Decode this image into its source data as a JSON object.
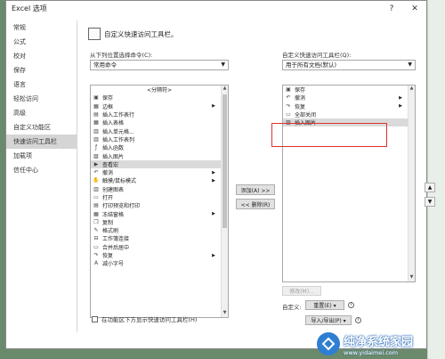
{
  "window": {
    "title": "Excel 选项",
    "help": "?",
    "close": "✕"
  },
  "nav": {
    "items": [
      "常规",
      "公式",
      "校对",
      "保存",
      "语言",
      "轻松访问",
      "高级",
      "自定义功能区",
      "快速访问工具栏",
      "加载项",
      "信任中心"
    ],
    "active_index": 8
  },
  "main": {
    "heading": "自定义快速访问工具栏。",
    "left_label": "从下列位置选择命令(C):",
    "left_select": "常用命令",
    "right_label": "自定义快速访问工具栏(Q):",
    "right_select": "用于所有文档(默认)",
    "commands": [
      {
        "icon": "",
        "label": "<分隔符>",
        "sub": false
      },
      {
        "icon": "save-icon",
        "label": "保存",
        "sub": false
      },
      {
        "icon": "border-icon",
        "label": "边框",
        "sub": true
      },
      {
        "icon": "insert-row-icon",
        "label": "插入工作表行",
        "sub": false
      },
      {
        "icon": "table-icon",
        "label": "插入表格",
        "sub": false
      },
      {
        "icon": "insert-cell-icon",
        "label": "插入单元格...",
        "sub": false
      },
      {
        "icon": "insert-col-icon",
        "label": "插入工作表列",
        "sub": false
      },
      {
        "icon": "function-icon",
        "label": "插入函数",
        "sub": false
      },
      {
        "icon": "picture-icon",
        "label": "插入图片",
        "sub": false
      },
      {
        "icon": "play-icon",
        "label": "查看宏",
        "sub": false
      },
      {
        "icon": "undo-icon",
        "label": "撤消",
        "sub": true
      },
      {
        "icon": "sort-icon",
        "label": "触摸/鼠标模式",
        "sub": true
      },
      {
        "icon": "chart-icon",
        "label": "创建图表",
        "sub": false
      },
      {
        "icon": "folder-open-icon",
        "label": "打开",
        "sub": false
      },
      {
        "icon": "print-preview-icon",
        "label": "打印预览和打印",
        "sub": false
      },
      {
        "icon": "freeze-panes-icon",
        "label": "冻结窗格",
        "sub": true
      },
      {
        "icon": "copy-icon",
        "label": "复制",
        "sub": false
      },
      {
        "icon": "format-painter-icon",
        "label": "格式刷",
        "sub": false
      },
      {
        "icon": "link-icon",
        "label": "工作簿连接",
        "sub": false
      },
      {
        "icon": "merge-icon",
        "label": "合并后居中",
        "sub": false
      },
      {
        "icon": "redo-icon",
        "label": "恢复",
        "sub": true
      },
      {
        "icon": "font-smaller-icon",
        "label": "减小字号",
        "sub": false
      }
    ],
    "qat_items": [
      {
        "icon": "save-icon",
        "label": "保存",
        "sub": false
      },
      {
        "icon": "undo-icon",
        "label": "撤消",
        "sub": true
      },
      {
        "icon": "redo-icon",
        "label": "恢复",
        "sub": true
      },
      {
        "icon": "close-all-icon",
        "label": "全部关闭",
        "sub": false
      },
      {
        "icon": "picture-icon",
        "label": "插入图片",
        "sub": false
      }
    ],
    "qat_selected_index": 4,
    "add_button": "添加(A) >>",
    "remove_button": "<< 删除(R)",
    "modify_button": "修改(M)...",
    "customize_label": "自定义:",
    "reset_button": "重置(E) ▾",
    "import_export_button": "导入/导出(P) ▾",
    "show_below_ribbon": "在功能区下方显示快速访问工具栏(H)",
    "info_glyph": "i",
    "up_arrow": "▲",
    "down_arrow": "▼"
  },
  "watermark": {
    "title": "纯净系统家园",
    "url": "www.yidaimei.com"
  },
  "colors": {
    "highlight_box": "#e03030",
    "nav_active": "#d5d5d5",
    "watermark_blue": "#2e7fd1"
  }
}
